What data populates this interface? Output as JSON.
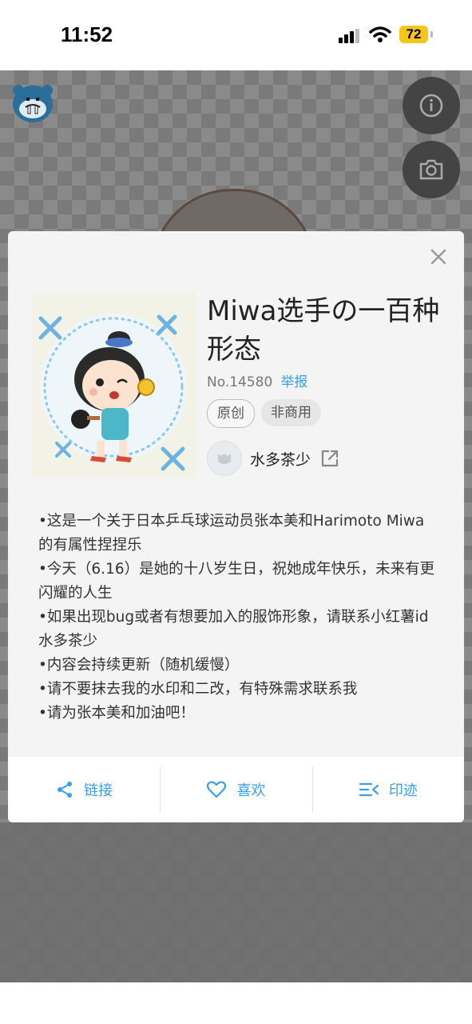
{
  "status_bar": {
    "time": "11:52",
    "battery": "72"
  },
  "modal": {
    "title": "Miwa选手の一百种形态",
    "number": "No.14580",
    "report_label": "举报",
    "tags": [
      "原创",
      "非商用"
    ],
    "author": {
      "name": "水多茶少"
    },
    "description": [
      "•这是一个关于日本乒乓球运动员张本美和Harimoto Miwa的有属性捏捏乐",
      "•今天（6.16）是她的十八岁生日，祝她成年快乐，未来有更闪耀的人生",
      "•如果出现bug或者有想要加入的服饰形象，请联系小红薯id 水多茶少",
      "•内容会持续更新（随机缓慢）",
      "•请不要抹去我的水印和二改，有特殊需求联系我",
      "•请为张本美和加油吧！"
    ],
    "actions": {
      "link": "链接",
      "like": "喜欢",
      "traces": "印迹"
    }
  },
  "colors": {
    "accent": "#3b9ee8",
    "battery": "#f5c518"
  },
  "icons": [
    "walrus-logo-icon",
    "info-icon",
    "camera-icon",
    "close-icon",
    "external-link-icon",
    "share-icon",
    "heart-icon",
    "traces-icon"
  ]
}
